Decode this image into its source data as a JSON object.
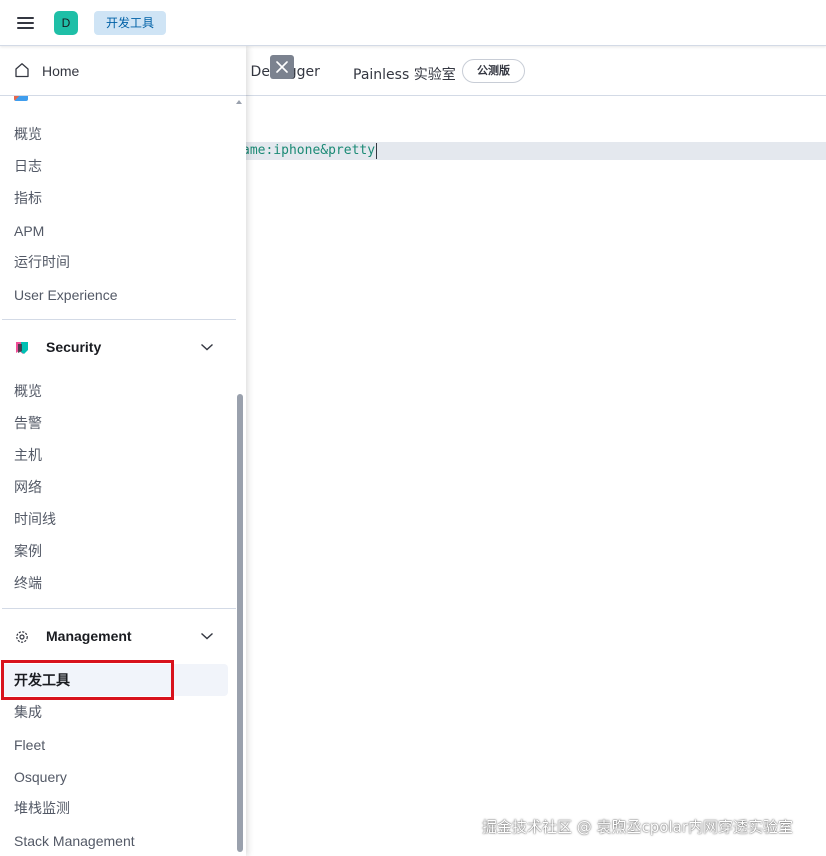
{
  "header": {
    "menu_icon": "hamburger-icon",
    "space_initial": "D",
    "space_color": "#1fbfa7",
    "breadcrumb": "开发工具"
  },
  "devtools": {
    "tab_grok_partial": "k Debugger",
    "tab_painless": "Painless 实验室",
    "beta_badge": "公测版",
    "editor_line": "ame:iphone&pretty"
  },
  "sidenav": {
    "home": {
      "label": "Home",
      "icon": "home-icon"
    },
    "observability_items": [
      "概览",
      "日志",
      "指标",
      "APM",
      "运行时间",
      "User Experience"
    ],
    "security": {
      "title": "Security",
      "icon": "security-shield-icon",
      "items": [
        "概览",
        "告警",
        "主机",
        "网络",
        "时间线",
        "案例",
        "终端"
      ]
    },
    "management": {
      "title": "Management",
      "icon": "gear-icon",
      "items": [
        "开发工具",
        "集成",
        "Fleet",
        "Osquery",
        "堆栈监测",
        "Stack Management"
      ],
      "active_item": "开发工具"
    }
  },
  "highlight_color": "#d8121c",
  "watermark": "掘金技术社区 @ 袁煦丞cpolar内网穿透实验室"
}
